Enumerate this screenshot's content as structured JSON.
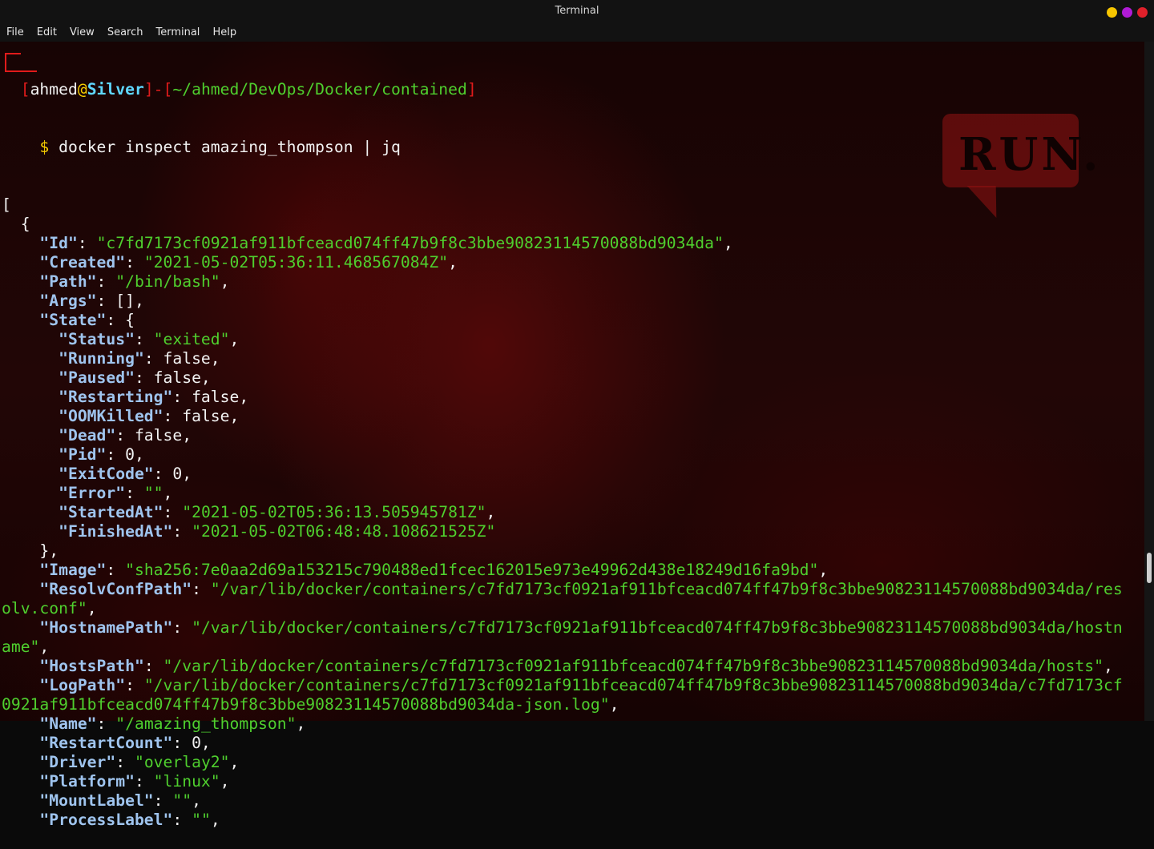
{
  "window": {
    "title": "Terminal",
    "buttons": [
      {
        "name": "minimize",
        "color": "#f7c600"
      },
      {
        "name": "maximize",
        "color": "#b01bd6"
      },
      {
        "name": "close",
        "color": "#e0202a"
      }
    ]
  },
  "menu": [
    "File",
    "Edit",
    "View",
    "Search",
    "Terminal",
    "Help"
  ],
  "prompt": {
    "user": "ahmed",
    "at": "@",
    "host": "Silver",
    "sep": "]-[",
    "cwd": "~/ahmed/DevOps/Docker/contained",
    "close": "]",
    "symbol": "$",
    "command": "docker inspect amazing_thompson | jq"
  },
  "background": {
    "bubble_text": "RUN."
  },
  "output": [
    [
      {
        "t": "["
      }
    ],
    [
      {
        "t": "  {"
      }
    ],
    [
      {
        "t": "    "
      },
      {
        "c": "k",
        "t": "\"Id\""
      },
      {
        "t": ": "
      },
      {
        "c": "s",
        "t": "\"c7fd7173cf0921af911bfceacd074ff47b9f8c3bbe90823114570088bd9034da\""
      },
      {
        "t": ","
      }
    ],
    [
      {
        "t": "    "
      },
      {
        "c": "k",
        "t": "\"Created\""
      },
      {
        "t": ": "
      },
      {
        "c": "s",
        "t": "\"2021-05-02T05:36:11.468567084Z\""
      },
      {
        "t": ","
      }
    ],
    [
      {
        "t": "    "
      },
      {
        "c": "k",
        "t": "\"Path\""
      },
      {
        "t": ": "
      },
      {
        "c": "s",
        "t": "\"/bin/bash\""
      },
      {
        "t": ","
      }
    ],
    [
      {
        "t": "    "
      },
      {
        "c": "k",
        "t": "\"Args\""
      },
      {
        "t": ": [],"
      }
    ],
    [
      {
        "t": "    "
      },
      {
        "c": "k",
        "t": "\"State\""
      },
      {
        "t": ": {"
      }
    ],
    [
      {
        "t": "      "
      },
      {
        "c": "k",
        "t": "\"Status\""
      },
      {
        "t": ": "
      },
      {
        "c": "s",
        "t": "\"exited\""
      },
      {
        "t": ","
      }
    ],
    [
      {
        "t": "      "
      },
      {
        "c": "k",
        "t": "\"Running\""
      },
      {
        "t": ": false,"
      }
    ],
    [
      {
        "t": "      "
      },
      {
        "c": "k",
        "t": "\"Paused\""
      },
      {
        "t": ": false,"
      }
    ],
    [
      {
        "t": "      "
      },
      {
        "c": "k",
        "t": "\"Restarting\""
      },
      {
        "t": ": false,"
      }
    ],
    [
      {
        "t": "      "
      },
      {
        "c": "k",
        "t": "\"OOMKilled\""
      },
      {
        "t": ": false,"
      }
    ],
    [
      {
        "t": "      "
      },
      {
        "c": "k",
        "t": "\"Dead\""
      },
      {
        "t": ": false,"
      }
    ],
    [
      {
        "t": "      "
      },
      {
        "c": "k",
        "t": "\"Pid\""
      },
      {
        "t": ": 0,"
      }
    ],
    [
      {
        "t": "      "
      },
      {
        "c": "k",
        "t": "\"ExitCode\""
      },
      {
        "t": ": 0,"
      }
    ],
    [
      {
        "t": "      "
      },
      {
        "c": "k",
        "t": "\"Error\""
      },
      {
        "t": ": "
      },
      {
        "c": "s",
        "t": "\"\""
      },
      {
        "t": ","
      }
    ],
    [
      {
        "t": "      "
      },
      {
        "c": "k",
        "t": "\"StartedAt\""
      },
      {
        "t": ": "
      },
      {
        "c": "s",
        "t": "\"2021-05-02T05:36:13.505945781Z\""
      },
      {
        "t": ","
      }
    ],
    [
      {
        "t": "      "
      },
      {
        "c": "k",
        "t": "\"FinishedAt\""
      },
      {
        "t": ": "
      },
      {
        "c": "s",
        "t": "\"2021-05-02T06:48:48.108621525Z\""
      }
    ],
    [
      {
        "t": "    },"
      }
    ],
    [
      {
        "t": "    "
      },
      {
        "c": "k",
        "t": "\"Image\""
      },
      {
        "t": ": "
      },
      {
        "c": "s",
        "t": "\"sha256:7e0aa2d69a153215c790488ed1fcec162015e973e49962d438e18249d16fa9bd\""
      },
      {
        "t": ","
      }
    ],
    [
      {
        "t": "    "
      },
      {
        "c": "k",
        "t": "\"ResolvConfPath\""
      },
      {
        "t": ": "
      },
      {
        "c": "s",
        "t": "\"/var/lib/docker/containers/c7fd7173cf0921af911bfceacd074ff47b9f8c3bbe90823114570088bd9034da/res"
      }
    ],
    [
      {
        "c": "s",
        "t": "olv.conf\""
      },
      {
        "t": ","
      }
    ],
    [
      {
        "t": "    "
      },
      {
        "c": "k",
        "t": "\"HostnamePath\""
      },
      {
        "t": ": "
      },
      {
        "c": "s",
        "t": "\"/var/lib/docker/containers/c7fd7173cf0921af911bfceacd074ff47b9f8c3bbe90823114570088bd9034da/hostn"
      }
    ],
    [
      {
        "c": "s",
        "t": "ame\""
      },
      {
        "t": ","
      }
    ],
    [
      {
        "t": "    "
      },
      {
        "c": "k",
        "t": "\"HostsPath\""
      },
      {
        "t": ": "
      },
      {
        "c": "s",
        "t": "\"/var/lib/docker/containers/c7fd7173cf0921af911bfceacd074ff47b9f8c3bbe90823114570088bd9034da/hosts\""
      },
      {
        "t": ","
      }
    ],
    [
      {
        "t": "    "
      },
      {
        "c": "k",
        "t": "\"LogPath\""
      },
      {
        "t": ": "
      },
      {
        "c": "s",
        "t": "\"/var/lib/docker/containers/c7fd7173cf0921af911bfceacd074ff47b9f8c3bbe90823114570088bd9034da/c7fd7173cf"
      }
    ],
    [
      {
        "c": "s",
        "t": "0921af911bfceacd074ff47b9f8c3bbe90823114570088bd9034da-json.log\""
      },
      {
        "t": ","
      }
    ],
    [
      {
        "t": "    "
      },
      {
        "c": "k",
        "t": "\"Name\""
      },
      {
        "t": ": "
      },
      {
        "c": "s",
        "t": "\"/amazing_thompson\""
      },
      {
        "t": ","
      }
    ],
    [
      {
        "t": "    "
      },
      {
        "c": "k",
        "t": "\"RestartCount\""
      },
      {
        "t": ": 0,"
      }
    ],
    [
      {
        "t": "    "
      },
      {
        "c": "k",
        "t": "\"Driver\""
      },
      {
        "t": ": "
      },
      {
        "c": "s",
        "t": "\"overlay2\""
      },
      {
        "t": ","
      }
    ],
    [
      {
        "t": "    "
      },
      {
        "c": "k",
        "t": "\"Platform\""
      },
      {
        "t": ": "
      },
      {
        "c": "s",
        "t": "\"linux\""
      },
      {
        "t": ","
      }
    ],
    [
      {
        "t": "    "
      },
      {
        "c": "k",
        "t": "\"MountLabel\""
      },
      {
        "t": ": "
      },
      {
        "c": "s",
        "t": "\"\""
      },
      {
        "t": ","
      }
    ],
    [
      {
        "t": "    "
      },
      {
        "c": "k",
        "t": "\"ProcessLabel\""
      },
      {
        "t": ": "
      },
      {
        "c": "s",
        "t": "\"\""
      },
      {
        "t": ","
      }
    ]
  ]
}
